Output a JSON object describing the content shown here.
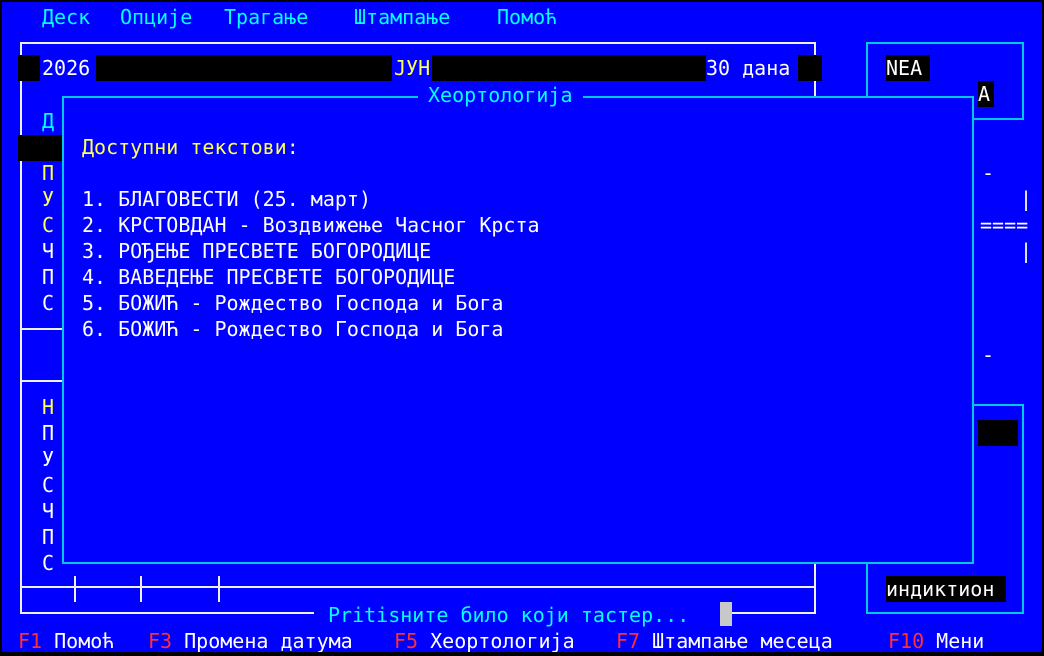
{
  "menu": {
    "items": [
      "Деск",
      "Опције",
      "Трагање",
      "Штампање",
      "Помоћ"
    ]
  },
  "calendar": {
    "year": "2026",
    "month": "ЈУН",
    "days": "30 дана",
    "left_labels_top": [
      "Д",
      "П",
      "У",
      "С",
      "Ч",
      "П",
      "С"
    ],
    "left_labels_bottom": [
      "Н",
      "П",
      "У",
      "С",
      "Ч",
      "П",
      "С"
    ]
  },
  "right_panel": {
    "nea": "NEA",
    "a": "А",
    "indiktion": "индиктион"
  },
  "dialog": {
    "title": "Хеортологија",
    "heading": "Доступни текстови:",
    "items": [
      "1. БЛАГОВЕСТИ (25. март)",
      "2. КРСТОВДАН - Воздвижење Часног Крста",
      "3. РОЂЕЊЕ ПРЕСВЕТЕ БОГОРОДИЦЕ",
      "4. ВАВЕДЕЊЕ ПРЕСВЕТЕ БОГОРОДИЦЕ",
      "5. БОЖИЋ - Рождество Господа и Бога",
      "6. БОЖИЋ - Рождество Господа и Бога"
    ]
  },
  "prompt": "Pritisните било који тастер...",
  "status_bar": {
    "items": [
      {
        "key": "F1",
        "label": "Помоћ"
      },
      {
        "key": "F3",
        "label": "Промена датума"
      },
      {
        "key": "F5",
        "label": "Хеортологија"
      },
      {
        "key": "F7",
        "label": "Штампање месеца"
      },
      {
        "key": "F10",
        "label": "Мени"
      }
    ]
  }
}
